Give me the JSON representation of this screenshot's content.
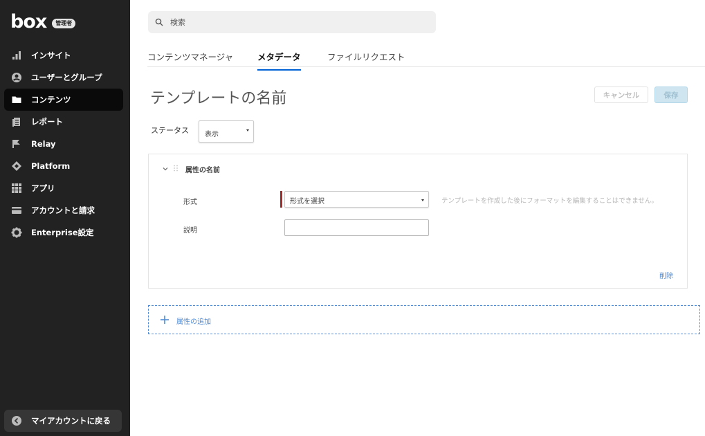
{
  "brand": {
    "logo_text": "box",
    "badge": "管理者"
  },
  "sidebar": {
    "items": [
      {
        "label": "インサイト",
        "icon": "bar-chart-icon"
      },
      {
        "label": "ユーザーとグループ",
        "icon": "user-circle-icon"
      },
      {
        "label": "コンテンツ",
        "icon": "folder-icon",
        "active": true
      },
      {
        "label": "レポート",
        "icon": "report-icon"
      },
      {
        "label": "Relay",
        "icon": "relay-flag-icon"
      },
      {
        "label": "Platform",
        "icon": "platform-diamond-icon"
      },
      {
        "label": "アプリ",
        "icon": "apps-grid-icon"
      },
      {
        "label": "アカウントと請求",
        "icon": "credit-card-icon"
      },
      {
        "label": "Enterprise設定",
        "icon": "gear-icon"
      }
    ],
    "back_label": "マイアカウントに戻る"
  },
  "search": {
    "placeholder": "検索"
  },
  "tabs": [
    {
      "label": "コンテンツマネージャ"
    },
    {
      "label": "メタデータ",
      "active": true
    },
    {
      "label": "ファイルリクエスト"
    }
  ],
  "template": {
    "title": "テンプレートの名前",
    "cancel_label": "キャンセル",
    "save_label": "保存",
    "status_label": "ステータス",
    "status_value": "表示"
  },
  "attribute": {
    "name": "属性の名前",
    "format_label": "形式",
    "format_value": "形式を選択",
    "format_hint": "テンプレートを作成した後にフォーマットを編集することはできません。",
    "description_label": "説明",
    "description_value": "",
    "delete_label": "削除"
  },
  "add_attribute_label": "属性の追加",
  "colors": {
    "sidebar_bg": "#222222",
    "accent_blue": "#0061d5",
    "link_blue": "#4f8cd6",
    "required_red": "#a02c2c"
  }
}
